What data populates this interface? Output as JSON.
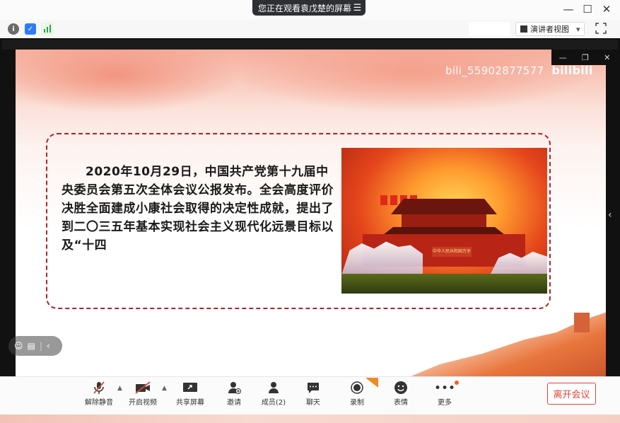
{
  "top": {
    "share_banner": "您正在观看袁戊楚的屏幕",
    "menu_icon": "list-icon",
    "window_controls": [
      "—",
      "☐",
      "✕"
    ]
  },
  "toolbar": {
    "presenter_view": "演讲者视图",
    "presenter_caret": "▾",
    "fullscreen_icon": "fullscreen-icon"
  },
  "slide": {
    "watermark": "bili_55902877577",
    "watermark_logo": "bilibili",
    "body_text": "2020年10月29日，中国共产党第十九届中央委员会第五次全体会议公报发布。全会高度评价决胜全面建成小康社会取得的决定性成就，提出了到二〇三五年基本实现社会主义现代化远景目标以及“十四",
    "photo_sign": "中华人民共和国万岁"
  },
  "bottom": {
    "buttons": [
      {
        "label": "解除静音",
        "icon": "mic-muted-icon"
      },
      {
        "label": "开启视频",
        "icon": "video-off-icon"
      },
      {
        "label": "共享屏幕",
        "icon": "share-screen-icon"
      },
      {
        "label": "邀请",
        "icon": "invite-icon"
      },
      {
        "label": "成员(2)",
        "icon": "members-icon"
      },
      {
        "label": "聊天",
        "icon": "chat-icon"
      },
      {
        "label": "录制",
        "icon": "record-icon"
      },
      {
        "label": "表情",
        "icon": "emoji-icon"
      },
      {
        "label": "更多",
        "icon": "more-icon"
      }
    ],
    "leave": "离开会议"
  },
  "colors": {
    "accent_red": "#e0463a",
    "banner_bg": "#2d2f33",
    "dashed_border": "#b3202a"
  }
}
